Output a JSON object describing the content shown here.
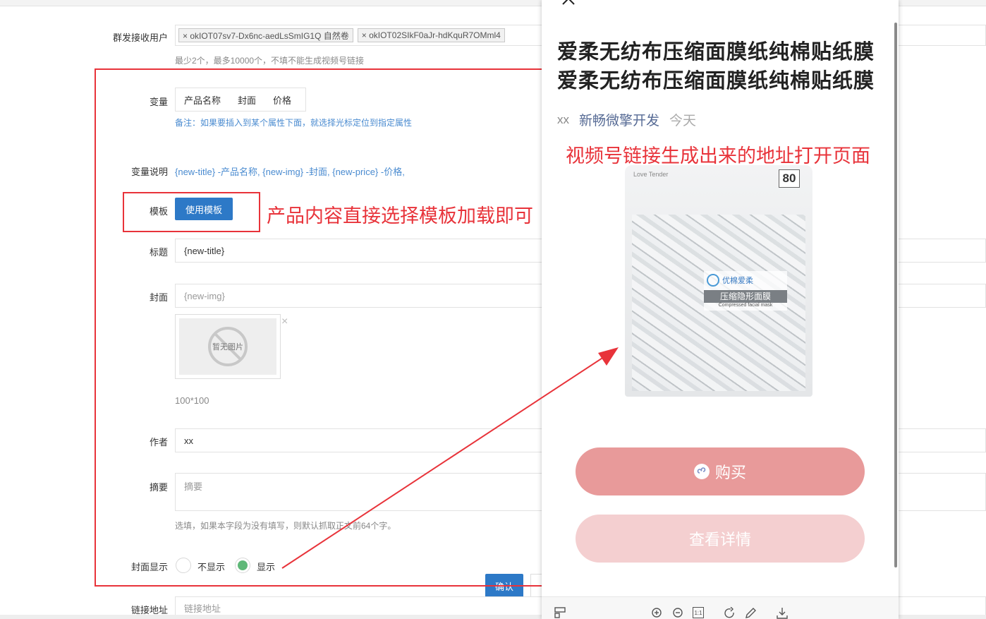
{
  "form": {
    "recipients": {
      "label": "群发接收用户",
      "tags": [
        "× okIOT07sv7-Dx6nc-aedLsSmIG1Q 自然卷",
        "× okIOT02SIkF0aJr-hdKquR7OMml4"
      ],
      "hint": "最少2个，最多10000个，不填不能生成视频号链接"
    },
    "variables": {
      "label": "变量",
      "items": [
        "产品名称",
        "封面",
        "价格"
      ],
      "note": "备注：如果要插入到某个属性下面，就选择光标定位到指定属性"
    },
    "variable_desc": {
      "label": "变量说明",
      "text": "{new-title} -产品名称, {new-img} -封面, {new-price} -价格,"
    },
    "template": {
      "label": "模板",
      "button": "使用模板"
    },
    "title": {
      "label": "标题",
      "value": "{new-title}"
    },
    "cover": {
      "label": "封面",
      "value": "{new-img}",
      "placeholder_image_text": "暂无图片",
      "remove_icon": "×",
      "size_hint": "100*100"
    },
    "author": {
      "label": "作者",
      "value": "xx"
    },
    "summary": {
      "label": "摘要",
      "placeholder": "摘要",
      "hint": "选填，如果本字段为没有填写，则默认抓取正文前64个字。"
    },
    "cover_display": {
      "label": "封面显示",
      "options": [
        "不显示",
        "显示"
      ],
      "selected": "显示"
    },
    "confirm_button": "确认",
    "link": {
      "label": "链接地址",
      "placeholder": "链接地址"
    }
  },
  "annotations": {
    "template_note": "产品内容直接选择模板加载即可",
    "preview_note": "视频号链接生成出来的地址打开页面"
  },
  "preview": {
    "title_line1": "爱柔无纺布压缩面膜纸纯棉贴纸膜",
    "title_line2": "爱柔无纺布压缩面膜纸纯棉贴纸膜",
    "author": "xx",
    "account": "新畅微擎开发",
    "date": "今天",
    "product": {
      "brand": "Love Tender",
      "count": "80",
      "logo_text": "优棉爱柔",
      "name_cn": "压缩隐形面膜",
      "name_en": "Compressed facial mask"
    },
    "buy_button": "购买",
    "detail_button": "查看详情",
    "toolbar_icons": [
      "layout-icon",
      "zoom-in-icon",
      "zoom-out-icon",
      "actual-size-icon",
      "rotate-icon",
      "edit-icon",
      "download-icon"
    ],
    "actual_size_label": "1:1"
  },
  "colors": {
    "annotation_red": "#e8333a",
    "primary_blue": "#2d79c7",
    "buy_pink": "#e89a9a",
    "detail_pink": "#f4cfd0",
    "radio_green": "#5fb878"
  }
}
